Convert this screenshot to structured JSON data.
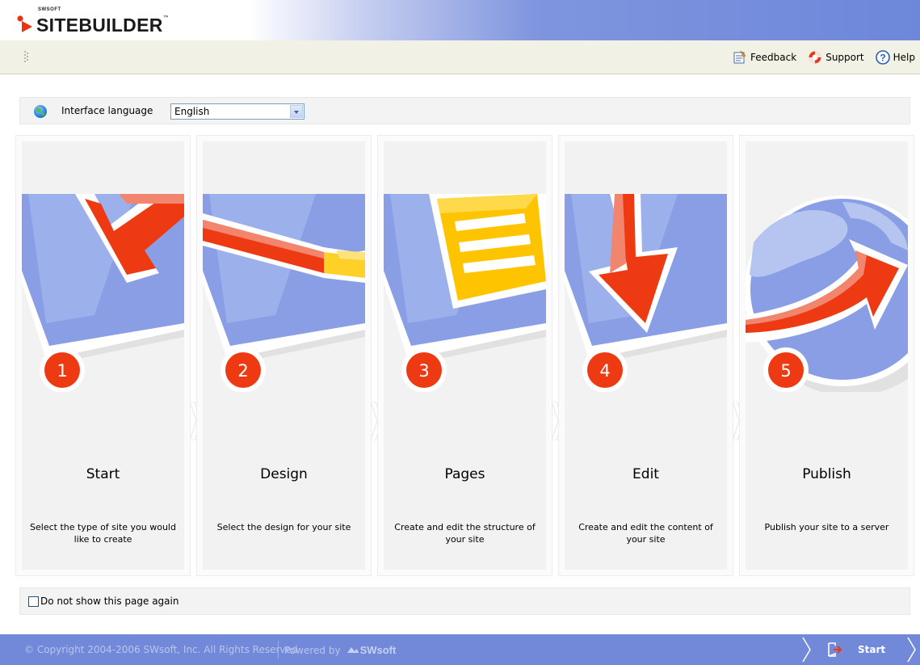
{
  "header": {
    "logo_small": "SWSOFT",
    "logo_text": "SITEBUILDER",
    "logo_tm": "™"
  },
  "toolbar": {
    "feedback_label": "Feedback",
    "support_label": "Support",
    "help_label": "Help"
  },
  "language": {
    "label": "Interface language",
    "selected": "English"
  },
  "steps": [
    {
      "number": "1",
      "title": "Start",
      "description": "Select the type of site you would like to create"
    },
    {
      "number": "2",
      "title": "Design",
      "description": "Select the design for your site"
    },
    {
      "number": "3",
      "title": "Pages",
      "description": "Create and edit the structure of your site"
    },
    {
      "number": "4",
      "title": "Edit",
      "description": "Create and edit the content of your site"
    },
    {
      "number": "5",
      "title": "Publish",
      "description": "Publish your site to a server"
    }
  ],
  "options": {
    "dont_show_label": "Do not show this page again",
    "dont_show_checked": false
  },
  "footer": {
    "copyright": "© Copyright 2004-2006 SWsoft, Inc. All Rights Reserved",
    "powered_by": "Powered by",
    "powered_brand": "SWsoft",
    "start_label": "Start"
  },
  "colors": {
    "header_blue": "#6d87da",
    "footer_blue": "#7189d8",
    "toolbar_bg": "#f2f1e6",
    "accent_red": "#ee3311",
    "card_blue": "#7f95e0",
    "card_yellow": "#ffc107"
  },
  "icons": {
    "feedback": "feedback-icon",
    "support": "lifebuoy-icon",
    "help": "question-icon",
    "language": "globe-icon",
    "start": "exit-arrow-icon"
  }
}
